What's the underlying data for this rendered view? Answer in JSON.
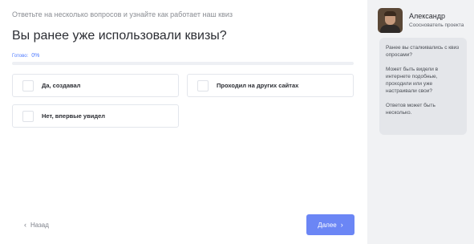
{
  "header": {
    "subtitle": "Ответьте на несколько вопросов и узнайте как работает наш квиз",
    "question": "Вы ранее уже использовали квизы?"
  },
  "progress": {
    "label": "Готово:",
    "percent_text": "0%",
    "fraction": 0
  },
  "options": [
    {
      "label": "Да, создавал"
    },
    {
      "label": "Проходил на других сайтах"
    },
    {
      "label": "Нет, впервые увидел"
    }
  ],
  "footer": {
    "back_label": "Назад",
    "next_label": "Далее"
  },
  "sidebar": {
    "name": "Александр",
    "role": "Сооснователь проекта",
    "paragraphs": [
      "Ранее вы сталкивались с квиз опросами?",
      "Может быть видели в интернете подобные, проходили или уже настраивали свои?",
      "Ответов может быть несколько."
    ]
  },
  "colors": {
    "accent": "#4f7bff",
    "button": "#6b86f5",
    "sidebar_bg": "#f1f2f4"
  }
}
